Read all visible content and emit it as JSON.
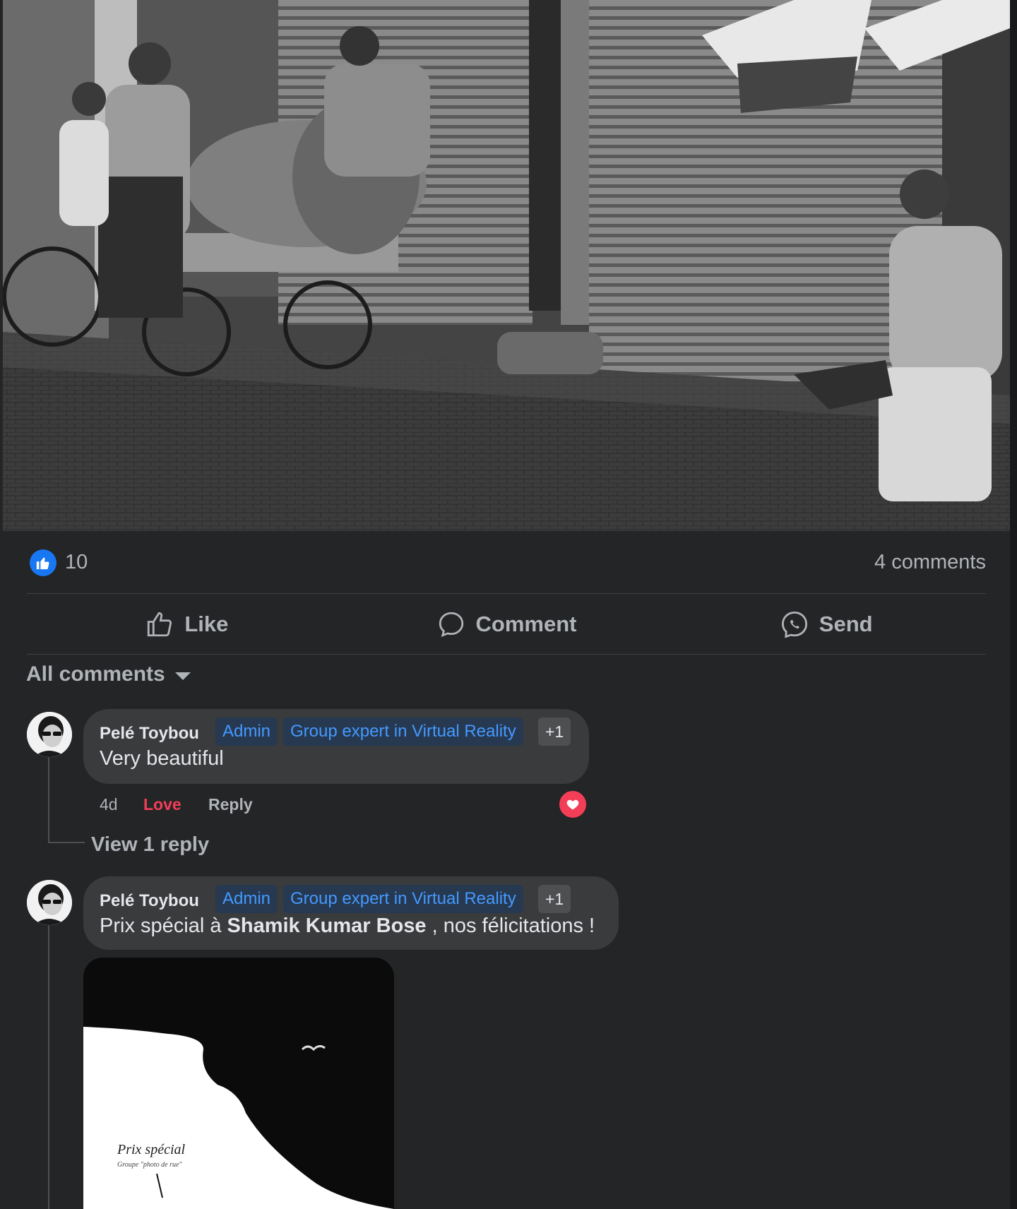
{
  "post": {
    "photo_name": "street-photo",
    "reactions": {
      "icon": "thumbs-up-icon",
      "count": "10"
    },
    "comments_count": "4 comments"
  },
  "actions": {
    "like": {
      "label": "Like",
      "icon": "thumbs-up-outline-icon"
    },
    "comment": {
      "label": "Comment",
      "icon": "comment-bubble-icon"
    },
    "send": {
      "label": "Send",
      "icon": "messenger-send-icon"
    }
  },
  "filter": {
    "label": "All comments",
    "icon": "chevron-down-icon"
  },
  "comments": [
    {
      "author": "Pelé Toybou",
      "badges": [
        "Admin",
        "Group expert in Virtual Reality"
      ],
      "extra_badges": "+1",
      "text": "Very beautiful",
      "time": "4d",
      "reaction_label": "Love",
      "reply_label": "Reply",
      "reaction_icon": "heart-icon",
      "view_replies": "View 1 reply"
    },
    {
      "author": "Pelé Toybou",
      "badges": [
        "Admin",
        "Group expert in Virtual Reality"
      ],
      "extra_badges": "+1",
      "text_prefix": "Prix spécial à ",
      "mention": "Shamik Kumar Bose",
      "text_suffix": " , nos félicitations !",
      "attachment": {
        "title": "Prix spécial",
        "subtitle": "Groupe \"photo de rue\""
      }
    }
  ],
  "colors": {
    "background": "#242526",
    "bubble": "#3a3b3c",
    "accent_blue": "#1877f2",
    "badge_text": "#4599ff",
    "love_red": "#f33e58"
  }
}
